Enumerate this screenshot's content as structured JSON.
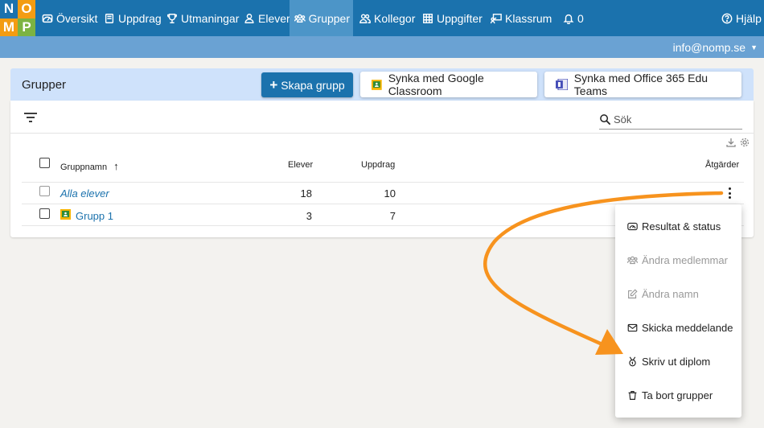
{
  "logo": {
    "letters": [
      "N",
      "O",
      "M",
      "P"
    ],
    "colors": [
      "#1b72ad",
      "#f39c12",
      "#f39c12",
      "#7cb342"
    ]
  },
  "nav": {
    "items": [
      {
        "label": "Översikt",
        "icon": "gauge-icon"
      },
      {
        "label": "Uppdrag",
        "icon": "book-icon"
      },
      {
        "label": "Utmaningar",
        "icon": "trophy-icon"
      },
      {
        "label": "Elever",
        "icon": "user-icon"
      },
      {
        "label": "Grupper",
        "icon": "users-icon",
        "active": true
      },
      {
        "label": "Kollegor",
        "icon": "colleagues-icon"
      },
      {
        "label": "Uppgifter",
        "icon": "table-icon"
      },
      {
        "label": "Klassrum",
        "icon": "classroom-icon"
      },
      {
        "label": "0",
        "icon": "bell-icon"
      }
    ],
    "help": "Hjälp"
  },
  "account": {
    "email": "info@nomp.se"
  },
  "header": {
    "title": "Grupper",
    "create_button": "Skapa grupp",
    "google_button": "Synka med Google Classroom",
    "office_button": "Synka med Office 365 Edu Teams"
  },
  "search": {
    "placeholder": "Sök"
  },
  "table": {
    "columns": {
      "name": "Gruppnamn",
      "students": "Elever",
      "assignments": "Uppdrag",
      "actions": "Åtgärder"
    },
    "rows": [
      {
        "name": "Alla elever",
        "students": "18",
        "assignments": "10"
      },
      {
        "name": "Grupp 1",
        "students": "3",
        "assignments": "7"
      }
    ]
  },
  "menu": {
    "items": [
      {
        "label": "Resultat & status",
        "icon": "gauge-icon",
        "disabled": false
      },
      {
        "label": "Ändra medlemmar",
        "icon": "users-icon",
        "disabled": true
      },
      {
        "label": "Ändra namn",
        "icon": "edit-icon",
        "disabled": true
      },
      {
        "label": "Skicka meddelande",
        "icon": "envelope-icon",
        "disabled": false
      },
      {
        "label": "Skriv ut diplom",
        "icon": "medal-icon",
        "disabled": false
      },
      {
        "label": "Ta bort grupper",
        "icon": "trash-icon",
        "disabled": false
      }
    ]
  },
  "colors": {
    "nav": "#1b72ad",
    "nav_active": "#4c95c8",
    "subbar": "#6aa2d3",
    "header_card": "#cfe2fb",
    "arrow": "#f7931e"
  }
}
